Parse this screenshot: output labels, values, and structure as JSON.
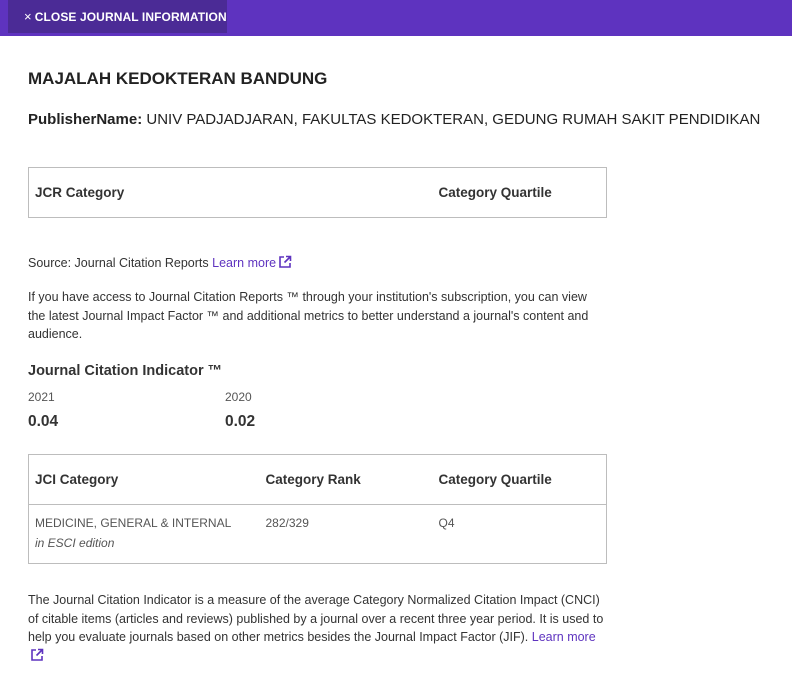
{
  "header": {
    "close_label": "CLOSE JOURNAL INFORMATION",
    "close_icon": "×"
  },
  "journal": {
    "title": "MAJALAH KEDOKTERAN BANDUNG",
    "publisher_label": "PublisherName:",
    "publisher_value": "UNIV PADJADJARAN, FAKULTAS KEDOKTERAN, GEDUNG RUMAH SAKIT PENDIDIKAN"
  },
  "jcr_table": {
    "headers": [
      "JCR Category",
      "Category Quartile"
    ]
  },
  "source": {
    "text": "Source: Journal Citation Reports",
    "link": "Learn more"
  },
  "access_text": "If you have access to Journal Citation Reports ™ through your institution's subscription, you can view the latest Journal Impact Factor ™ and additional metrics to better understand a journal's content and audience.",
  "jci": {
    "heading": "Journal Citation Indicator ™",
    "years": [
      "2021",
      "2020"
    ],
    "values": [
      "0.04",
      "0.02"
    ]
  },
  "jci_table": {
    "headers": [
      "JCI Category",
      "Category Rank",
      "Category Quartile"
    ],
    "row": {
      "category": "MEDICINE, GENERAL & INTERNAL",
      "edition": "in ESCI edition",
      "rank": "282/329",
      "quartile": "Q4"
    }
  },
  "description": {
    "text": "The Journal Citation Indicator is a measure of the average Category Normalized Citation Impact (CNCI) of citable items (articles and reviews) published by a journal over a recent three year period. It is used to help you evaluate journals based on other metrics besides the Journal Impact Factor (JIF).",
    "link": "Learn more"
  },
  "colors": {
    "brand": "#5e33bf",
    "brand_dark": "#4b2b96"
  }
}
